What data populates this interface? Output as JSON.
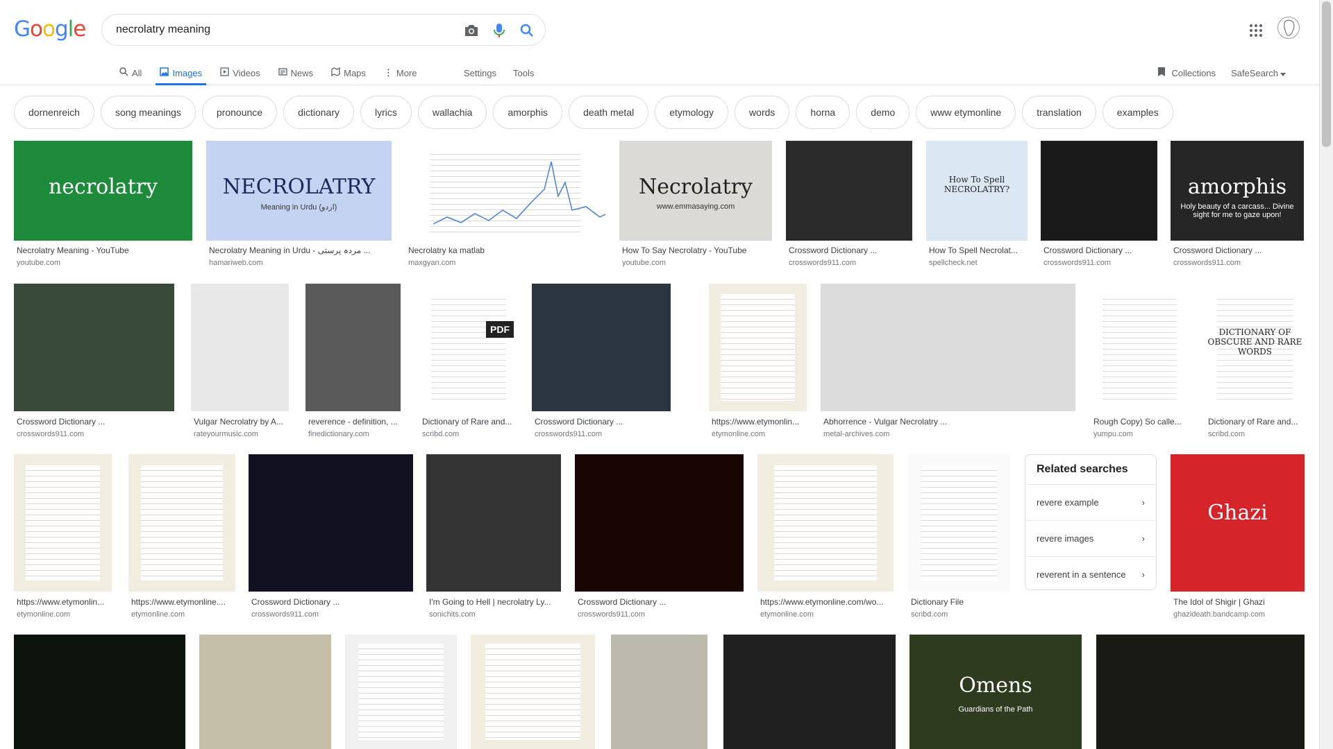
{
  "search": {
    "query": "necrolatry meaning"
  },
  "logo": {
    "letters": [
      "G",
      "o",
      "o",
      "g",
      "l",
      "e"
    ],
    "colors": [
      "#4285f4",
      "#ea4335",
      "#fbbc05",
      "#4285f4",
      "#34a853",
      "#ea4335"
    ]
  },
  "tabs": [
    {
      "label": "All",
      "icon": "search-icon"
    },
    {
      "label": "Images",
      "icon": "image-icon"
    },
    {
      "label": "Videos",
      "icon": "video-icon"
    },
    {
      "label": "News",
      "icon": "news-icon"
    },
    {
      "label": "Maps",
      "icon": "map-icon"
    },
    {
      "label": "More",
      "icon": "more-vert-icon"
    }
  ],
  "tools": {
    "settings": "Settings",
    "tools": "Tools"
  },
  "right": {
    "collections": "Collections",
    "safesearch": "SafeSearch"
  },
  "chips": [
    "dornenreich",
    "song meanings",
    "pronounce",
    "dictionary",
    "lyrics",
    "wallachia",
    "amorphis",
    "death metal",
    "etymology",
    "words",
    "horna",
    "demo",
    "www etymonline",
    "translation",
    "examples"
  ],
  "results": [
    {
      "title": "Necrolatry Meaning - YouTube",
      "source": "youtube.com",
      "thumb_text": "necrolatry",
      "color": "#1e8a3b"
    },
    {
      "title": "Necrolatry Meaning in Urdu - مردہ پرستی ...",
      "source": "hamariweb.com",
      "thumb_text": "NECROLATRY",
      "thumb_sub": "Meaning in Urdu (اردو)",
      "color": "#c5d3f3"
    },
    {
      "title": "Necrolatry ka matlab",
      "source": "maxgyan.com",
      "color": "#ffffff"
    },
    {
      "title": "How To Say Necrolatry - YouTube",
      "source": "youtube.com",
      "thumb_text": "Necrolatry",
      "thumb_sub": "www.emmasaying.com",
      "color": "#dcdad6"
    },
    {
      "title": "Crossword Dictionary ...",
      "source": "crosswords911.com",
      "color": "#2a2a2a"
    },
    {
      "title": "How To Spell Necrolat...",
      "source": "spellcheck.net",
      "thumb_text": "How To Spell NECROLATRY?",
      "color": "#dbe7f2"
    },
    {
      "title": "Crossword Dictionary ...",
      "source": "crosswords911.com",
      "color": "#1a1a1a"
    },
    {
      "title": "Crossword Dictionary ...",
      "source": "crosswords911.com",
      "thumb_text": "amorphis",
      "thumb_sub": "Holy beauty of a carcass... Divine sight for me to gaze upon!",
      "color": "#262626"
    },
    {
      "title": "Crossword Dictionary ...",
      "source": "crosswords911.com",
      "color": "#3a4a3a"
    },
    {
      "title": "Vulgar Necrolatry by A...",
      "source": "rateyourmusic.com",
      "color": "#e8e8e8"
    },
    {
      "title": "reverence - definition, ...",
      "source": "finedictionary.com",
      "color": "#5a5a5a"
    },
    {
      "title": "Dictionary of Rare and...",
      "source": "scribd.com",
      "thumb_text": "PDF",
      "color": "#ffffff"
    },
    {
      "title": "Crossword Dictionary ...",
      "source": "crosswords911.com",
      "color": "#2b3540"
    },
    {
      "title": "https://www.etymonlin...",
      "source": "etymonline.com",
      "color": "#f1ede0"
    },
    {
      "title": "Abhorrence - Vulgar Necrolatry ...",
      "source": "metal-archives.com",
      "color": "#dcdcdc"
    },
    {
      "title": "Rough Copy) So calle...",
      "source": "yumpu.com",
      "color": "#ffffff"
    },
    {
      "title": "Dictionary of Rare and...",
      "source": "scribd.com",
      "thumb_text": "DICTIONARY OF OBSCURE AND RARE WORDS",
      "color": "#ffffff"
    },
    {
      "title": "https://www.etymonlin...",
      "source": "etymonline.com",
      "color": "#f1ede0"
    },
    {
      "title": "https://www.etymonline....",
      "source": "etymonline.com",
      "color": "#f1ede0"
    },
    {
      "title": "Crossword Dictionary ...",
      "source": "crosswords911.com",
      "color": "#111122"
    },
    {
      "title": "I'm Going to Hell | necrolatry Ly...",
      "source": "sonichits.com",
      "color": "#333333"
    },
    {
      "title": "Crossword Dictionary ...",
      "source": "crosswords911.com",
      "color": "#1a0505"
    },
    {
      "title": "https://www.etymonline.com/wo...",
      "source": "etymonline.com",
      "color": "#f1ede0"
    },
    {
      "title": "Dictionary File",
      "source": "scribd.com",
      "color": "#fafafa"
    },
    {
      "title": "The Idol of Shigir | Ghazi",
      "source": "ghazideath.bandcamp.com",
      "thumb_text": "Ghazi",
      "color": "#d6242b"
    },
    {
      "title": "",
      "source": "",
      "color": "#0d140d"
    },
    {
      "title": "",
      "source": "",
      "color": "#c6bfa8"
    },
    {
      "title": "",
      "source": "",
      "color": "#f0f0f0"
    },
    {
      "title": "",
      "source": "",
      "color": "#f1ede0"
    },
    {
      "title": "",
      "source": "",
      "color": "#bcb9ae"
    },
    {
      "title": "",
      "source": "",
      "color": "#202020"
    },
    {
      "title": "",
      "source": "",
      "thumb_text": "Omens",
      "thumb_sub": "Guardians of the Path",
      "color": "#2f3b1e"
    },
    {
      "title": "",
      "source": "",
      "color": "#191a14"
    }
  ],
  "related": {
    "heading": "Related searches",
    "items": [
      "revere example",
      "revere images",
      "reverent in a sentence"
    ]
  }
}
